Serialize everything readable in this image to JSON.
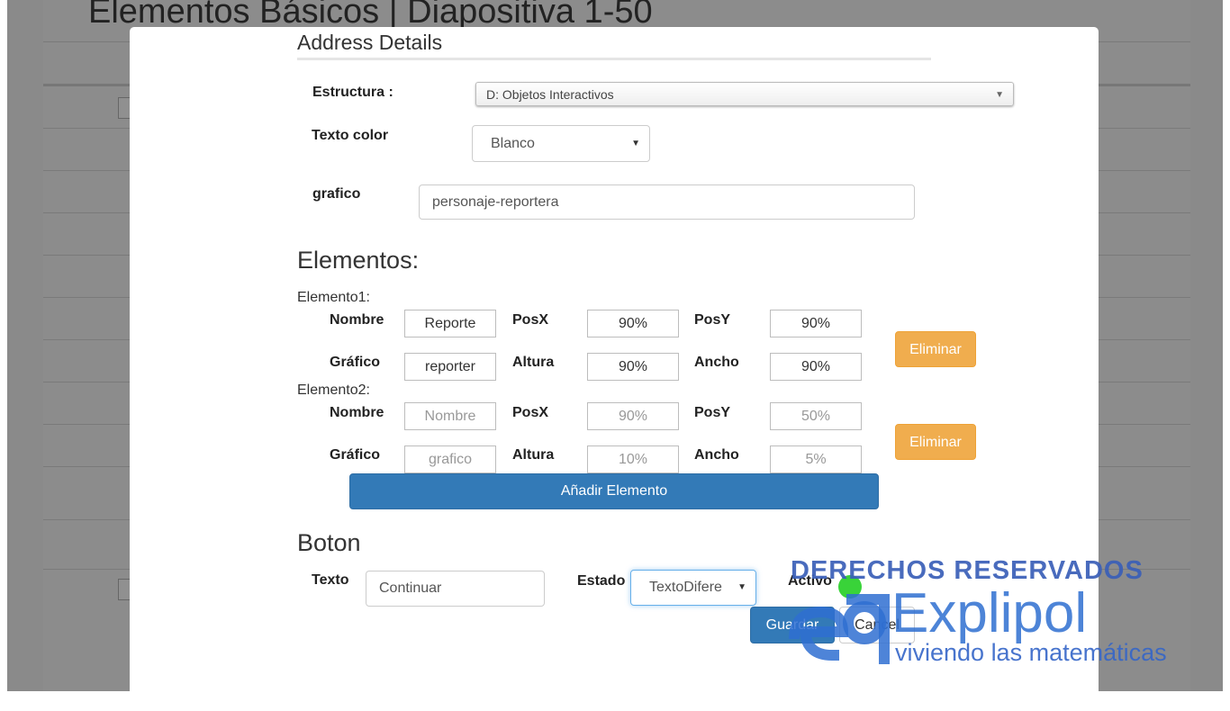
{
  "background_page": {
    "title": "Elementos Básicos | Diapositiva 1-50"
  },
  "modal": {
    "section_title": "Address Details",
    "estructura": {
      "label": "Estructura :",
      "value": "D: Objetos Interactivos"
    },
    "texto_color": {
      "label": "Texto color",
      "value": "Blanco"
    },
    "grafico": {
      "label": "grafico",
      "value": "personaje-reportera"
    },
    "elementos": {
      "title": "Elementos:",
      "col_labels": {
        "nombre": "Nombre",
        "grafico": "Gráfico",
        "posx": "PosX",
        "posy": "PosY",
        "altura": "Altura",
        "ancho": "Ancho"
      },
      "items": [
        {
          "heading": "Elemento1:",
          "nombre": "Reporte",
          "grafico": "reporter",
          "posx": "90%",
          "posy": "90%",
          "altura": "90%",
          "ancho": "90%",
          "delete_label": "Eliminar"
        },
        {
          "heading": "Elemento2:",
          "nombre": "Nombre",
          "grafico": "grafico",
          "posx": "90%",
          "posy": "50%",
          "altura": "10%",
          "ancho": "5%",
          "delete_label": "Eliminar"
        }
      ],
      "add_label": "Añadir Elemento"
    },
    "boton": {
      "title": "Boton",
      "texto_label": "Texto",
      "texto_value": "Continuar",
      "estado_label": "Estado",
      "estado_value": "TextoDifere",
      "activo_label": "Activo"
    },
    "save_label": "Guardar",
    "cancel_label": "Cancel"
  },
  "watermark": {
    "top": "DERECHOS RESERVADOS",
    "brand": "Explipol",
    "tagline": "viviendo las matemáticas"
  },
  "colors": {
    "primary": "#337ab7",
    "warning": "#f0ad4e",
    "toggle_on": "#39d339"
  }
}
